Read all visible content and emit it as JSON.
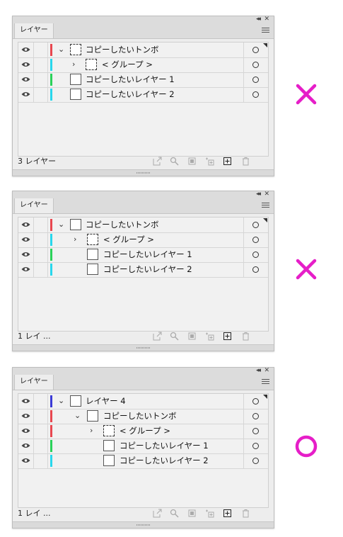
{
  "panels": [
    {
      "tab": "レイヤー",
      "count": "3 レイヤー",
      "rows": [
        {
          "label": "コピーしたいトンボ",
          "color": "#e8474f",
          "chevron": "down",
          "indent": 0,
          "thumb": "dashed"
        },
        {
          "label": "< グループ >",
          "color": "#28d7ec",
          "chevron": "right",
          "indent": 1,
          "thumb": "dashed"
        },
        {
          "label": "コピーしたいレイヤー 1",
          "color": "#2ad15a",
          "chevron": "",
          "indent": 0,
          "thumb": "solid"
        },
        {
          "label": "コピーしたいレイヤー 2",
          "color": "#28d7ec",
          "chevron": "",
          "indent": 0,
          "thumb": "solid"
        }
      ],
      "verdict": "✕"
    },
    {
      "tab": "レイヤー",
      "count": "1 レイ ...",
      "rows": [
        {
          "label": "コピーしたいトンボ",
          "color": "#e8474f",
          "chevron": "down",
          "indent": 0,
          "thumb": "solid"
        },
        {
          "label": "< グループ >",
          "color": "#28d7ec",
          "chevron": "right",
          "indent": 1,
          "thumb": "dashed"
        },
        {
          "label": "コピーしたいレイヤー 1",
          "color": "#2ad15a",
          "chevron": "",
          "indent": 1,
          "thumb": "solid"
        },
        {
          "label": "コピーしたいレイヤー 2",
          "color": "#28d7ec",
          "chevron": "",
          "indent": 1,
          "thumb": "solid"
        }
      ],
      "verdict": "✕"
    },
    {
      "tab": "レイヤー",
      "count": "1 レイ ...",
      "rows": [
        {
          "label": "レイヤー 4",
          "color": "#3b3bd6",
          "chevron": "down",
          "indent": 0,
          "thumb": "solid"
        },
        {
          "label": "コピーしたいトンボ",
          "color": "#e8474f",
          "chevron": "down",
          "indent": 1,
          "thumb": "solid"
        },
        {
          "label": "< グループ >",
          "color": "#e8474f",
          "chevron": "right",
          "indent": 2,
          "thumb": "dashed"
        },
        {
          "label": "コピーしたいレイヤー 1",
          "color": "#2ad15a",
          "chevron": "",
          "indent": 2,
          "thumb": "solid"
        },
        {
          "label": "コピーしたいレイヤー 2",
          "color": "#28d7ec",
          "chevron": "",
          "indent": 2,
          "thumb": "solid"
        }
      ],
      "verdict": "○"
    }
  ],
  "icons": {
    "visibility": "eye-icon",
    "target": "target-circle-icon",
    "footer": [
      "export-icon",
      "search-icon",
      "clip-mask-icon",
      "new-sublayer-icon",
      "new-layer-icon",
      "trash-icon"
    ]
  },
  "colors": {
    "mark": "#e61ec8"
  }
}
